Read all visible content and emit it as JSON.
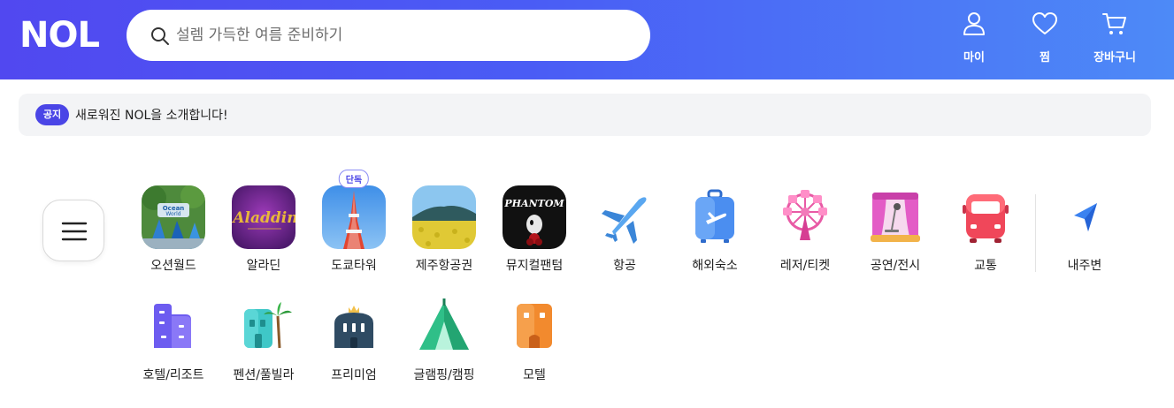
{
  "header": {
    "logo": "NOL",
    "search_placeholder": "설렘 가득한 여름 준비하기",
    "nav": [
      {
        "label": "마이",
        "icon": "user-icon"
      },
      {
        "label": "찜",
        "icon": "heart-icon"
      },
      {
        "label": "장바구니",
        "icon": "cart-icon"
      }
    ]
  },
  "notice": {
    "badge": "공지",
    "text": "새로워진 NOL을 소개합니다!"
  },
  "categories_row1": [
    {
      "label": "오션월드",
      "icon": "ocean-world-thumbnail"
    },
    {
      "label": "알라딘",
      "icon": "aladdin-thumbnail"
    },
    {
      "label": "도쿄타워",
      "icon": "tokyo-tower-thumbnail",
      "badge": "단독"
    },
    {
      "label": "제주항공권",
      "icon": "jeju-thumbnail"
    },
    {
      "label": "뮤지컬팬텀",
      "icon": "phantom-thumbnail"
    },
    {
      "label": "항공",
      "icon": "airplane-icon"
    },
    {
      "label": "해외숙소",
      "icon": "suitcase-icon"
    },
    {
      "label": "레저/티켓",
      "icon": "ferris-wheel-icon"
    },
    {
      "label": "공연/전시",
      "icon": "stage-icon"
    },
    {
      "label": "교통",
      "icon": "bus-icon"
    },
    {
      "label": "내주변",
      "icon": "location-arrow-icon"
    }
  ],
  "categories_row2": [
    {
      "label": "호텔/리조트",
      "icon": "hotel-icon"
    },
    {
      "label": "펜션/풀빌라",
      "icon": "pension-icon"
    },
    {
      "label": "프리미엄",
      "icon": "premium-icon"
    },
    {
      "label": "글램핑/캠핑",
      "icon": "tent-icon"
    },
    {
      "label": "모텔",
      "icon": "motel-icon"
    }
  ],
  "thumb_text": {
    "phantom": "PHANTOM",
    "aladdin": "Aladdin",
    "ocean": "Ocean World"
  },
  "colors": {
    "header_start": "#5148f0",
    "header_end": "#4d8af7",
    "badge": "#4a45e6"
  }
}
